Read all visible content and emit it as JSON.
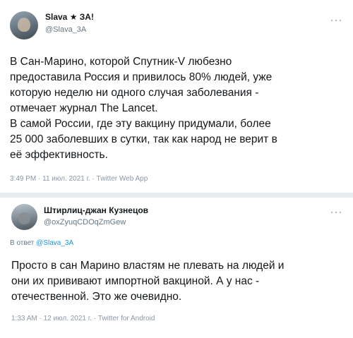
{
  "tweet1": {
    "author_name": "Slava ★ ЗА!",
    "author_handle": "@Slava_3A",
    "more_icon": "more-dots-icon",
    "lines": [
      "В Сан-Марино, которой Спутник-V любезно",
      "предоставила Россия и привилось 80% людей, уже",
      "которую неделю ни одного случая заболевания -",
      "отмечает журнал The Lancet.",
      "В самой России, где эту вакцину придумали, более",
      "25 000 заболевших в сутки, так как народ не верит в",
      "её эффективность."
    ],
    "meta": "3:49 PM · 11 июл. 2021 г. · Twitter Web App"
  },
  "tweet2": {
    "author_name": "Штирлиц-джан Кузнецов",
    "author_handle": "@oxZyuqCDOqZmGew",
    "more_icon": "more-dots-icon",
    "reply_prefix": "В ответ",
    "reply_mention": "@Slava_3A",
    "lines": [
      "Просто в сан Марино властям не плевать на людей и",
      "они их прививают импортной вакциной. А у нас -",
      "отечественной. Это же очевидно."
    ],
    "meta": "1:33 AM · 12 июл. 2021 г. · Twitter for Android"
  },
  "colors": {
    "text": "#14171a",
    "secondary": "#657786",
    "link": "#1b95e0",
    "divider": "#e6ecf0"
  }
}
